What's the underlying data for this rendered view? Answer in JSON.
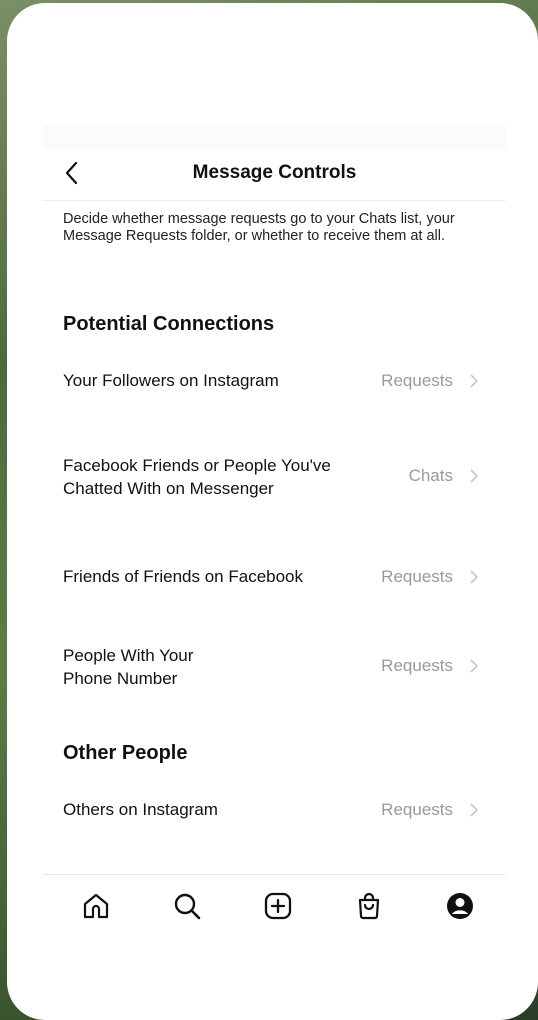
{
  "header": {
    "title": "Message Controls",
    "back_icon": "chevron-left-icon"
  },
  "description": "Decide whether message requests go to your Chats list, your Message Requests folder, or whether to receive them at all.",
  "sections": [
    {
      "title": "Potential Connections",
      "items": [
        {
          "label_lines": [
            "Your Followers on Instagram"
          ],
          "value": "Requests"
        },
        {
          "label_lines": [
            "Facebook Friends or People You've",
            "Chatted With on Messenger"
          ],
          "value": "Chats"
        },
        {
          "label_lines": [
            "Friends of Friends on Facebook"
          ],
          "value": "Requests"
        },
        {
          "label_lines": [
            "People With Your",
            "Phone Number"
          ],
          "value": "Requests"
        }
      ]
    },
    {
      "title": "Other People",
      "items": [
        {
          "label_lines": [
            "Others on Instagram"
          ],
          "value": "Requests"
        }
      ]
    }
  ],
  "tabbar": {
    "items": [
      {
        "icon": "home-icon"
      },
      {
        "icon": "search-icon"
      },
      {
        "icon": "create-post-icon"
      },
      {
        "icon": "shop-icon"
      },
      {
        "icon": "profile-icon"
      }
    ]
  },
  "colors": {
    "value_text": "#9a9a9a",
    "chevron": "#c7c7c7",
    "background_text": "#111111"
  }
}
